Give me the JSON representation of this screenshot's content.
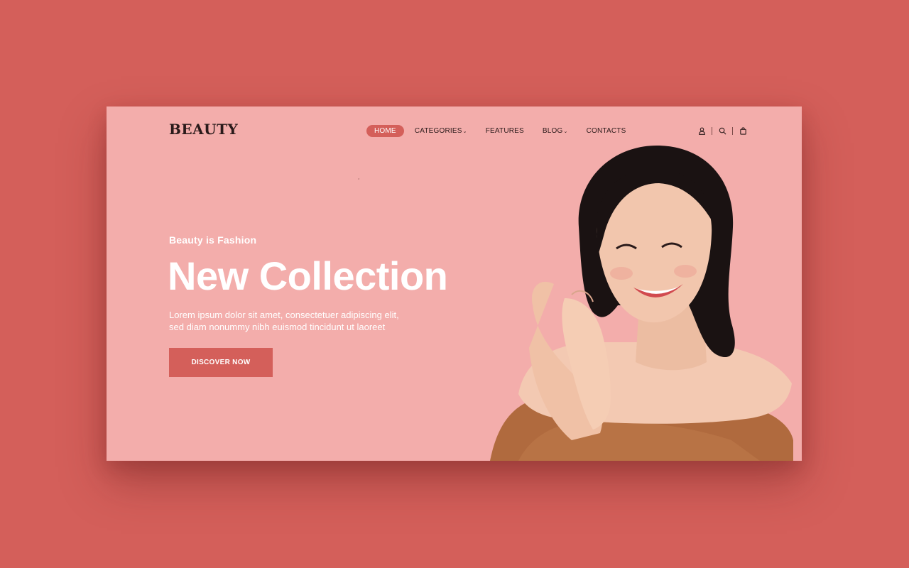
{
  "brand": {
    "logo_text": "BEAUTY"
  },
  "nav": {
    "items": [
      {
        "label": "HOME",
        "active": true,
        "has_dropdown": false
      },
      {
        "label": "CATEGORIES",
        "active": false,
        "has_dropdown": true
      },
      {
        "label": "FEATURES",
        "active": false,
        "has_dropdown": false
      },
      {
        "label": "BLOG",
        "active": false,
        "has_dropdown": true
      },
      {
        "label": "CONTACTS",
        "active": false,
        "has_dropdown": false
      }
    ],
    "dropdown_glyph": "⌄"
  },
  "header_icons": [
    "user-icon",
    "search-icon",
    "shopping-bag-icon"
  ],
  "hero": {
    "eyebrow": "Beauty is Fashion",
    "title": "New Collection",
    "description_line1": "Lorem ipsum dolor sit amet, consectetuer adipiscing elit,",
    "description_line2": "sed diam nonummy nibh euismod tincidunt ut laoreet",
    "cta_label": "DISCOVER NOW",
    "tiny_mark": "ˇ"
  },
  "colors": {
    "page_background": "#d45f5a",
    "frame_background": "#f3adab",
    "accent": "#d45f5a",
    "text_dark": "#2a1a1a",
    "text_light": "#ffffff"
  }
}
